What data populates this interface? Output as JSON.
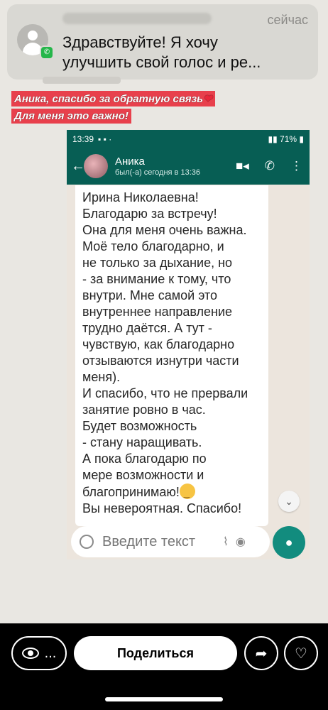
{
  "notification": {
    "time": "сейчас",
    "message_line1": "Здравствуйте! Я хочу",
    "message_line2": "улучшить свой голос и ре..."
  },
  "caption": {
    "line1": "Аника, спасибо за обратную связь",
    "line2": "Для меня это важно!",
    "emoji": "❤"
  },
  "whatsapp": {
    "status_time": "13:39",
    "battery": "71%",
    "contact_name": "Аника",
    "last_seen": "был(-а) сегодня в 13:36",
    "message_lines": [
      "Ирина Николаевна!",
      "Благодарю за встречу!",
      "Она для меня очень важна.",
      "Моё тело благодарно, и",
      "не только за дыхание, но",
      "- за внимание к тому, что",
      "внутри. Мне самой это",
      "внутреннее направление",
      "трудно даётся. А тут -",
      "чувствую, как благодарно",
      "отзываются изнутри части",
      "меня).",
      "И спасибо, что не прервали",
      "занятие ровно в час.",
      "Будет возможность",
      "- стану наращивать.",
      "А пока благодарю по",
      "мере возможности и",
      "благопринимаю!",
      "Вы невероятная. Спасибо!"
    ],
    "input_placeholder": "Введите текст"
  },
  "bottom": {
    "viewers_label": "...",
    "share_label": "Поделиться"
  }
}
